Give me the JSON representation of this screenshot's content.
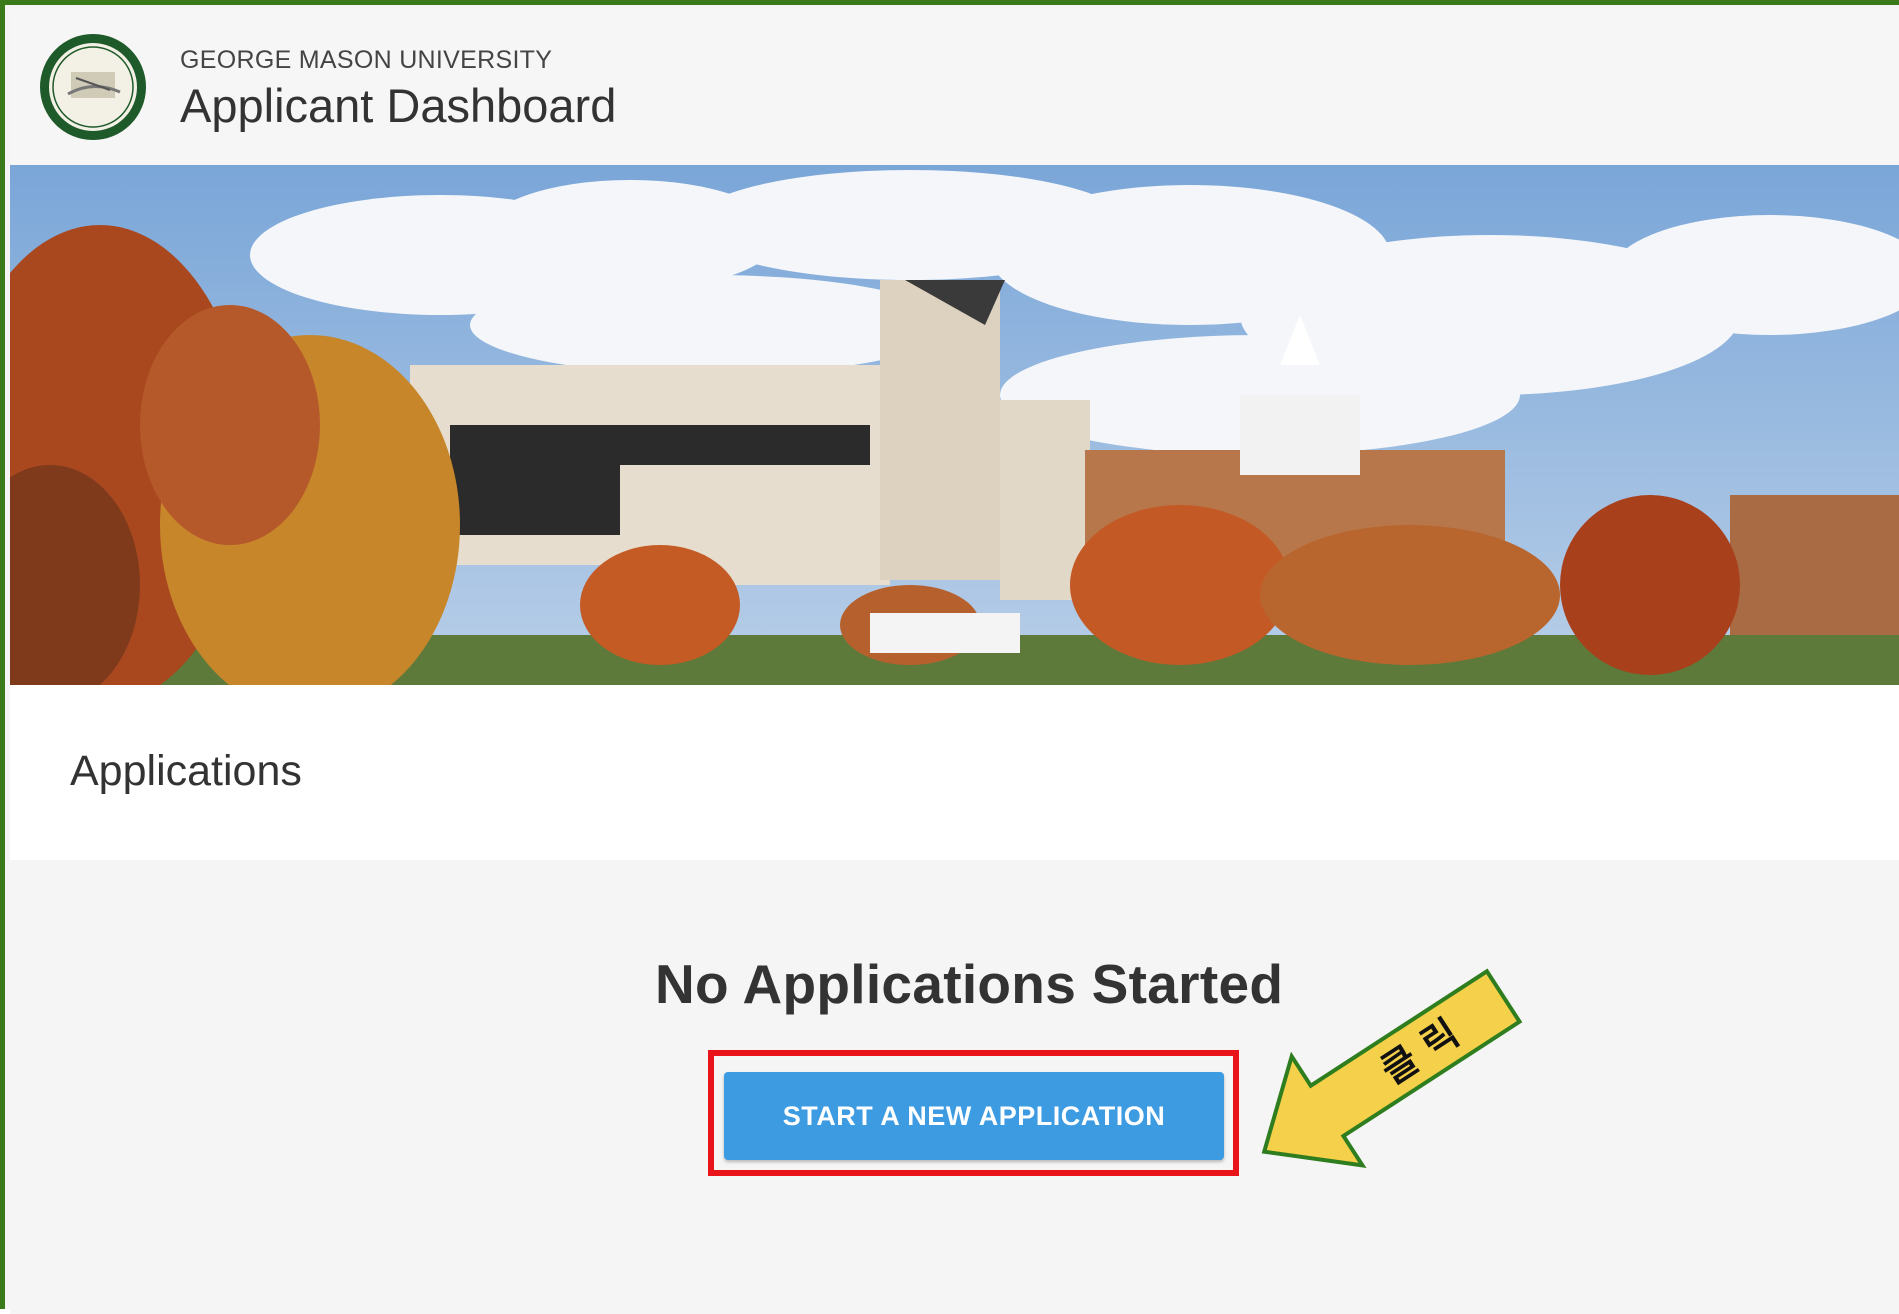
{
  "header": {
    "university": "GEORGE MASON UNIVERSITY",
    "title": "Applicant Dashboard"
  },
  "applications": {
    "section_title": "Applications",
    "empty_title": "No Applications Started",
    "start_button_label": "START A NEW APPLICATION"
  },
  "annotation": {
    "arrow_label": "클 릭",
    "highlight_color": "#e8141a",
    "arrow_color": "#f5d04a"
  },
  "colors": {
    "primary_button": "#3d9be2",
    "frame_border": "#3a7a1a"
  }
}
